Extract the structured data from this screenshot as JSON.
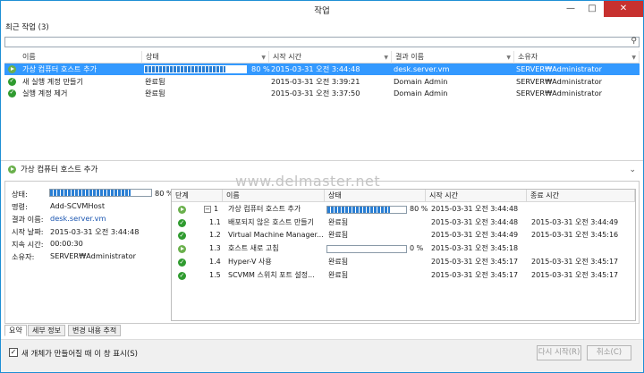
{
  "window": {
    "title": "작업",
    "minimize": "—",
    "maximize": "□",
    "close": "✕"
  },
  "recent": {
    "label": "최근 작업 (3)"
  },
  "search": {
    "placeholder": "",
    "icon": "search-icon"
  },
  "columns": [
    "이름",
    "상태",
    "시작 시간",
    "결과 이름",
    "소유자"
  ],
  "jobs": [
    {
      "icon": "running",
      "name": "가상 컴퓨터 호스트 추가",
      "status": "80 %",
      "progress": 0.8,
      "start": "2015-03-31 오전 3:44:48",
      "result": "desk.server.vm",
      "owner": "SERVER₩Administrator"
    },
    {
      "icon": "completed",
      "name": "새 실행 계정 만들기",
      "status": "완료됨",
      "start": "2015-03-31 오전 3:39:21",
      "result": "Domain Admin",
      "owner": "SERVER₩Administrator"
    },
    {
      "icon": "completed",
      "name": "실행 계정 제거",
      "status": "완료됨",
      "start": "2015-03-31 오전 3:37:50",
      "result": "Domain Admin",
      "owner": "SERVER₩Administrator"
    }
  ],
  "detail": {
    "title": "가상 컴퓨터 호스트 추가",
    "status_label": "상태:",
    "status_value": "80 %",
    "progress": 0.8,
    "command_label": "명령:",
    "command_value": "Add-SCVMHost",
    "result_label": "결과 이름:",
    "result_value": "desk.server.vm",
    "start_label": "시작 날짜:",
    "start_value": "2015-03-31 오전 3:44:48",
    "duration_label": "지속 시간:",
    "duration_value": "00:00:30",
    "owner_label": "소유자:",
    "owner_value": "SERVER₩Administrator"
  },
  "watermark": "www.delmaster.net",
  "steps_columns": [
    "단계",
    "이름",
    "상태",
    "시작 시간",
    "종료 시간"
  ],
  "steps": [
    {
      "icon": "running",
      "step": "1",
      "name": "가상 컴퓨터 호스트 추가",
      "status": "80 %",
      "progress": 0.8,
      "start": "2015-03-31 오전 3:44:48",
      "end": ""
    },
    {
      "icon": "completed",
      "step": "1.1",
      "name": "배포되지 않은 호스트 만들기",
      "status": "완료됨",
      "start": "2015-03-31 오전 3:44:48",
      "end": "2015-03-31 오전 3:44:49"
    },
    {
      "icon": "completed",
      "step": "1.2",
      "name": "Virtual Machine Manager...",
      "status": "완료됨",
      "start": "2015-03-31 오전 3:44:49",
      "end": "2015-03-31 오전 3:45:16"
    },
    {
      "icon": "running",
      "step": "1.3",
      "name": "호스트 새로 고침",
      "status": "0 %",
      "progress": 0.0,
      "start": "2015-03-31 오전 3:45:18",
      "end": ""
    },
    {
      "icon": "completed",
      "step": "1.4",
      "name": "Hyper-V 사용",
      "status": "완료됨",
      "start": "2015-03-31 오전 3:45:17",
      "end": "2015-03-31 오전 3:45:17"
    },
    {
      "icon": "completed",
      "step": "1.5",
      "name": "SCVMM 스위치 포트 설정...",
      "status": "완료됨",
      "start": "2015-03-31 오전 3:45:17",
      "end": "2015-03-31 오전 3:45:17"
    }
  ],
  "tabs": [
    "요약",
    "세부 정보",
    "변경 내용 추적"
  ],
  "footer": {
    "checkbox_checked": true,
    "checkbox_label": "새 개체가 만들어질 때 이 창 표시(S)",
    "restart": "다시 시작(R)",
    "cancel": "취소(C)"
  }
}
